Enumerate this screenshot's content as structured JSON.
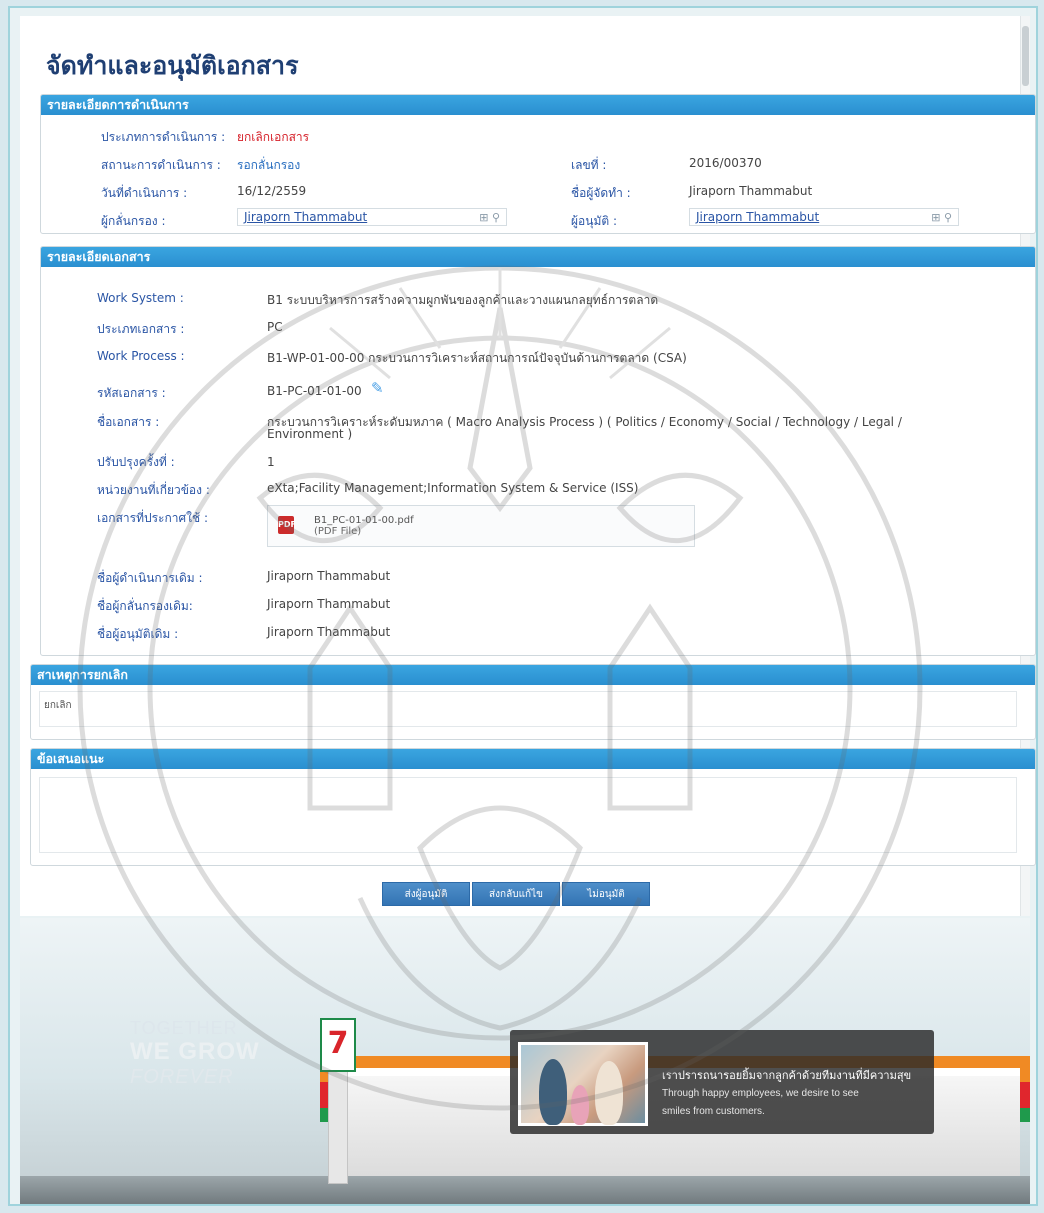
{
  "page_title": "จัดทำและอนุมัติเอกสาร",
  "operation": {
    "header": "รายละเอียดการดำเนินการ",
    "type_label": "ประเภทการดำเนินการ :",
    "type_value": "ยกเลิกเอกสาร",
    "status_label": "สถานะการดำเนินการ :",
    "status_value": "รอกลั่นกรอง",
    "number_label": "เลขที่ :",
    "number_value": "2016/00370",
    "date_label": "วันที่ดำเนินการ :",
    "date_value": "16/12/2559",
    "creator_label": "ชื่อผู้จัดทำ :",
    "creator_value": "Jiraporn Thammabut",
    "screener_label": "ผู้กลั่นกรอง :",
    "screener_value": "Jiraporn Thammabut",
    "approver_label": "ผู้อนุมัติ :",
    "approver_value": "Jiraporn Thammabut"
  },
  "document": {
    "header": "รายละเอียดเอกสาร",
    "work_system_label": "Work System :",
    "work_system_value": "B1 ระบบบริหารการสร้างความผูกพันของลูกค้าและวางแผนกลยุทธ์การตลาด",
    "doc_type_label": "ประเภทเอกสาร :",
    "doc_type_value": "PC",
    "work_process_label": "Work Process :",
    "work_process_value": "B1-WP-01-00-00 กระบวนการวิเคราะห์สถานการณ์ปัจจุบันด้านการตลาด (CSA)",
    "doc_code_label": "รหัสเอกสาร :",
    "doc_code_value": "B1-PC-01-01-00",
    "doc_name_label": "ชื่อเอกสาร :",
    "doc_name_line1": "กระบวนการวิเคราะห์ระดับมหภาค ( Macro Analysis Process ) ( Politics / Economy / Social / Technology / Legal /",
    "doc_name_line2": "Environment )",
    "revision_label": "ปรับปรุงครั้งที่ :",
    "revision_value": "1",
    "units_label": "หน่วยงานที่เกี่ยวข้อง :",
    "units_value": "eXta;Facility Management;Information System & Service (ISS)",
    "announced_label": "เอกสารที่ประกาศใช้ :",
    "file_name": "B1_PC-01-01-00.pdf",
    "file_type": "(PDF File)",
    "orig_operator_label": "ชื่อผู้ดำเนินการเดิม :",
    "orig_operator_value": "Jiraporn Thammabut",
    "orig_screener_label": "ชื่อผู้กลั่นกรองเดิม:",
    "orig_screener_value": "Jiraporn Thammabut",
    "orig_approver_label": "ชื่อผู้อนุมัติเดิม :",
    "orig_approver_value": "Jiraporn Thammabut"
  },
  "cancel": {
    "header": "สาเหตุการยกเลิก",
    "text": "ยกเลิก"
  },
  "suggestion": {
    "header": "ข้อเสนอแนะ",
    "text": ""
  },
  "buttons": {
    "send_approver": "ส่งผู้อนุมัติ",
    "send_back": "ส่งกลับแก้ไข",
    "not_approve": "ไม่อนุมัติ"
  },
  "banner": {
    "tagline_1": "TOGETHER",
    "tagline_2": "WE GROW",
    "tagline_3": "FOREVER",
    "sign_text": "7",
    "promo_th": "เราปรารถนารอยยิ้มจากลูกค้าด้วยทีมงานที่มีความสุข",
    "promo_en_1": "Through happy employees, we desire to see",
    "promo_en_2": "smiles from customers."
  },
  "colors": {
    "header_blue": "#2a8fd0",
    "title_navy": "#1f3f73",
    "label_blue": "#2a55a5",
    "status_red": "#d6222b",
    "button_blue": "#3374b4"
  },
  "icons": [
    "pdf-file-icon",
    "edit-pencil-icon",
    "add-icon",
    "search-icon"
  ]
}
